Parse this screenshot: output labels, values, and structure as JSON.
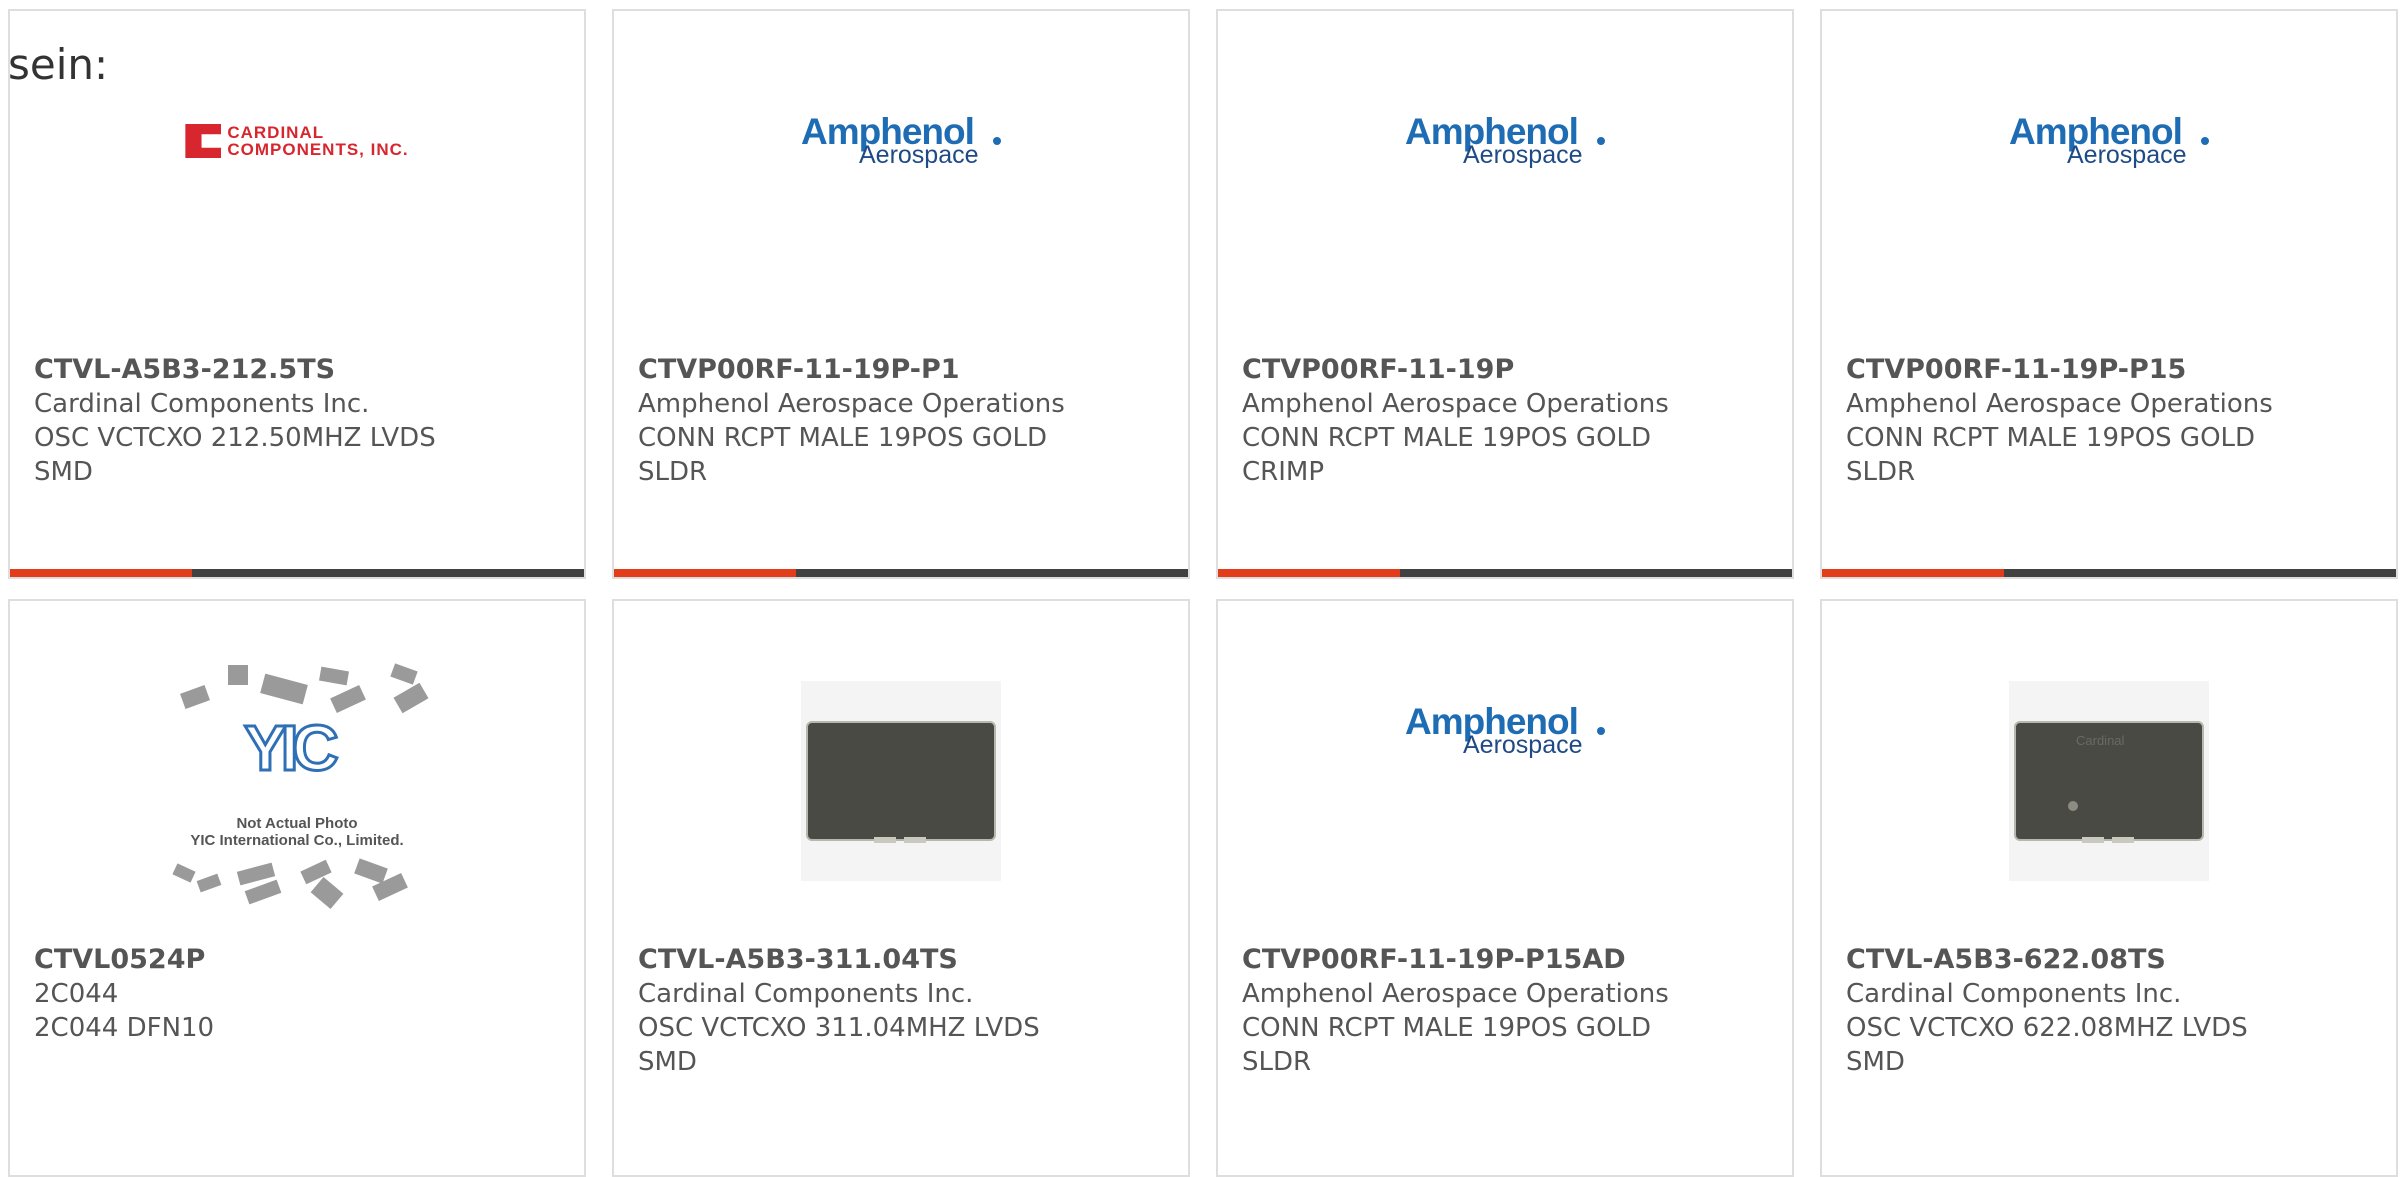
{
  "intro_text": "sein:",
  "theme": {
    "accent": "#e23c1a",
    "bar": "#414141",
    "border": "#dedede",
    "text": "#555555"
  },
  "cards": [
    {
      "part": "CTVL-A5B3-212.5TS",
      "maker": "Cardinal Components Inc.",
      "desc": "OSC VCTCXO 212.50MHZ LVDS SMD",
      "image": {
        "type": "logo-cardinal",
        "line1": "CARDINAL",
        "line2": "COMPONENTS, INC."
      }
    },
    {
      "part": "CTVP00RF-11-19P-P1",
      "maker": "Amphenol Aerospace Operations",
      "desc": "CONN RCPT MALE 19POS GOLD SLDR",
      "image": {
        "type": "logo-amphenol",
        "line1": "Amphenol",
        "line2": "Aerospace"
      }
    },
    {
      "part": "CTVP00RF-11-19P",
      "maker": "Amphenol Aerospace Operations",
      "desc": "CONN RCPT MALE 19POS GOLD CRIMP",
      "image": {
        "type": "logo-amphenol",
        "line1": "Amphenol",
        "line2": "Aerospace"
      }
    },
    {
      "part": "CTVP00RF-11-19P-P15",
      "maker": "Amphenol Aerospace Operations",
      "desc": "CONN RCPT MALE 19POS GOLD SLDR",
      "image": {
        "type": "logo-amphenol",
        "line1": "Amphenol",
        "line2": "Aerospace"
      }
    },
    {
      "part": "CTVL0524P",
      "maker": "2C044",
      "desc": "2C044 DFN10",
      "image": {
        "type": "placeholder-yic",
        "logo": "YIC",
        "line1": "Not Actual Photo",
        "line2": "YIC International Co., Limited."
      }
    },
    {
      "part": "CTVL-A5B3-311.04TS",
      "maker": "Cardinal Components Inc.",
      "desc": "OSC VCTCXO 311.04MHZ LVDS SMD",
      "image": {
        "type": "chip-photo",
        "brand": ""
      }
    },
    {
      "part": "CTVP00RF-11-19P-P15AD",
      "maker": "Amphenol Aerospace Operations",
      "desc": "CONN RCPT MALE 19POS GOLD SLDR",
      "image": {
        "type": "logo-amphenol",
        "line1": "Amphenol",
        "line2": "Aerospace"
      }
    },
    {
      "part": "CTVL-A5B3-622.08TS",
      "maker": "Cardinal Components Inc.",
      "desc": "OSC VCTCXO 622.08MHZ LVDS SMD",
      "image": {
        "type": "chip-photo",
        "brand": "Cardinal"
      }
    }
  ]
}
